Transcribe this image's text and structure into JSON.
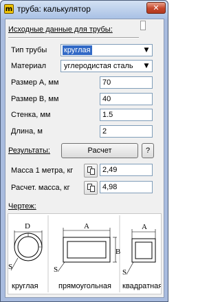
{
  "window": {
    "title": "труба: калькулятор",
    "icon_letter": "m",
    "close_glyph": "✕"
  },
  "inputs_section": {
    "heading": "Исходные данные для трубы:"
  },
  "pipe_type": {
    "label": "Тип трубы",
    "value": "круглая"
  },
  "material": {
    "label": "Материал",
    "value": "углеродистая сталь"
  },
  "fields": {
    "size_a": {
      "label": "Размер А, мм",
      "value": "70"
    },
    "size_b": {
      "label": "Размер В, мм",
      "value": "40"
    },
    "wall": {
      "label": "Стенка, мм",
      "value": "1.5"
    },
    "length": {
      "label": "Длина, м",
      "value": "2"
    }
  },
  "results_section": {
    "heading": "Результаты:",
    "calc_button": "Расчет",
    "help_button": "?"
  },
  "results": {
    "mass_per_meter": {
      "label": "Масса 1 метра, кг",
      "value": "2,49"
    },
    "total_mass": {
      "label": "Расчет. масса, кг",
      "value": "4,98"
    }
  },
  "drawing_section": {
    "heading": "Чертеж:"
  },
  "drawings": {
    "round": {
      "caption": "круглая",
      "dims": [
        "D",
        "S"
      ]
    },
    "rect": {
      "caption": "прямоугольная",
      "dims": [
        "A",
        "B",
        "S"
      ]
    },
    "square": {
      "caption": "квадратная",
      "dims": [
        "A",
        "S"
      ]
    }
  },
  "colors": {
    "selection": "#3169c6",
    "titlebar": "#b8cbe8",
    "close": "#c5462a"
  }
}
